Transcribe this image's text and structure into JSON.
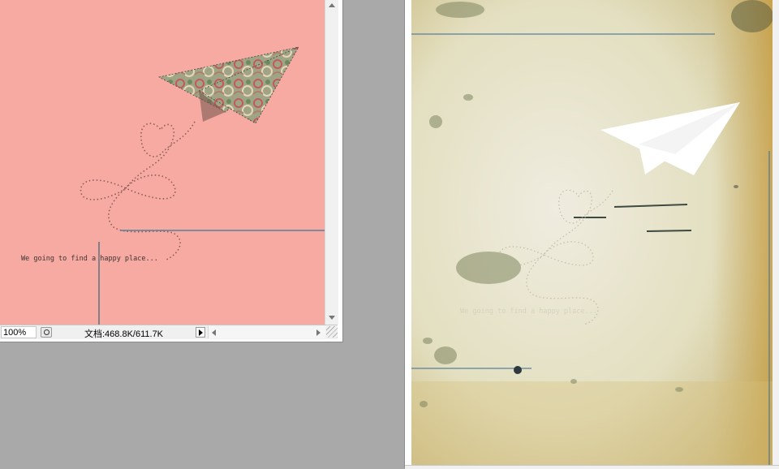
{
  "window_left": {
    "canvas_text": "We going to find a happy place...",
    "status": {
      "zoom": "100%",
      "doc_info": "文档:468.8K/611.7K"
    }
  },
  "window_right": {
    "canvas_text": "We going to find a happy place..."
  },
  "colors": {
    "workspace": "#a9a9a9",
    "pink_canvas": "#f7aaa1",
    "paper_canvas": "#e6e2c6",
    "guide_line": "#5a7f9a"
  },
  "icons": [
    "scroll-up-icon",
    "scroll-down-icon",
    "scroll-left-icon",
    "scroll-right-icon",
    "status-menu-arrow-icon",
    "resize-grip-icon"
  ]
}
